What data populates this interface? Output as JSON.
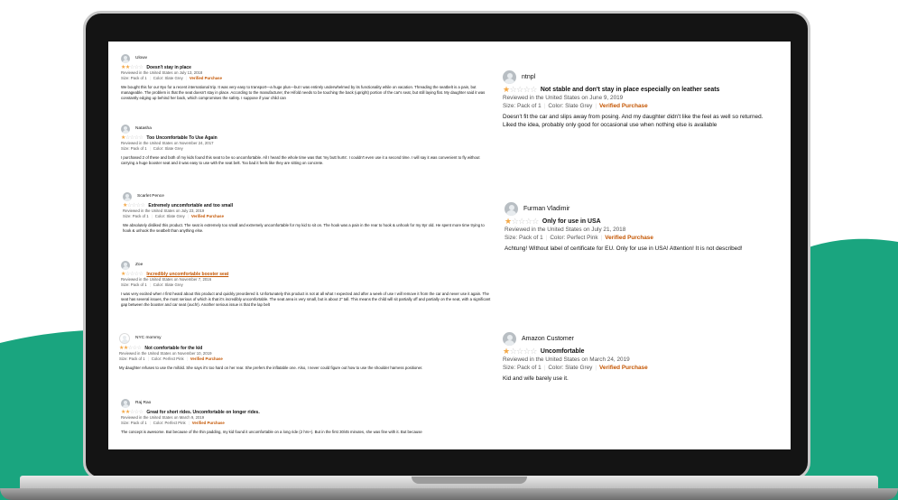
{
  "colors": {
    "green": "#1aa57f",
    "star": "#f3a847",
    "verified": "#c45500"
  },
  "reviews_left": [
    {
      "user": "Ulowv",
      "stars": 2,
      "title": "Doesn't stay in place",
      "date": "Reviewed in the United States on July 13, 2018",
      "size": "Size: Pack of 1",
      "color": "Color: Slate Grey",
      "verified": "Verified Purchase",
      "body": "We bought this for our 8yo for a recent international trip. It was very easy to transport—a huge plus—but I was entirely underwhelmed by its functionality while on vacation. Threading the seatbelt is a pain, but manageable. The problem is that the seat doesn't stay in place. According to the manufacturer, the Hifold needs to be touching the back (upright) portion of the car's seat, but still laying flat. My daughter said it was constantly edging up behind her back, which compromises the safety. I suppose if your child can"
    },
    {
      "user": "Natasha",
      "stars": 1,
      "title": "Too Uncomfortable To Use Again",
      "date": "Reviewed in the United States on November 24, 2017",
      "size": "Size: Pack of 1",
      "color": "Color: Slate Grey",
      "verified": "",
      "body": "I purchased 2 of these and both of my kids found this seat to be so uncomfortable. All I heard the whole time was that 'my butt hurts'. I couldn't even use it a second time. I will say it was convenient to fly without carrying a huge booster seat and it was easy to use with the seat belt. Too bad it feels like they are sitting on concrete."
    },
    {
      "user": "Scarlet Pence",
      "stars": 1,
      "title": "Extremely uncomfortable and too small",
      "date": "Reviewed in the United States on July 23, 2019",
      "size": "Size: Pack of 1",
      "color": "Color: Slate Grey",
      "verified": "Verified Purchase",
      "body": "We absolutely disliked this product. The seat is extremely too small and extremely uncomfortable for my kid to sit on. The hook was a pain in the rear to hook & unhook for my 8yr old. He spent more time trying to hook & unhook the seatbelt than anything else."
    },
    {
      "user": "Zoe",
      "stars": 1,
      "title": "Incredibly uncomfortable booster seat",
      "date": "Reviewed in the United States on November 7, 2016",
      "size": "Size: Pack of 1",
      "color": "Color: Slate Grey",
      "verified": "",
      "body": "I was very excited when I first heard about this product and quickly preordered it. Unfortunately this product is not at all what I expected and after a week of use I will remove it from the car and never use it again. The seat has several issues, the most serious of which is that it's incredibly uncomfortable. The seat area is very small, but is about 2\" tall. This means the child will sit partially off and partially on the seat, with a significant gap between the booster and car seat (ouch!). Another serious issue is that the lap belt"
    },
    {
      "user": "NYC mommy",
      "stars": 2,
      "title": "Not comfortable for the kid",
      "date": "Reviewed in the United States on November 10, 2019",
      "size": "Size: Pack of 1",
      "color": "Color: Perfect Pink",
      "verified": "Verified Purchase",
      "body": "My daughter refuses to use the mifold. She says it's too hard on her rear. She prefers the inflatable one. Also, I never could figure out how to use the shoulder harness positioner."
    },
    {
      "user": "Raj Rao",
      "stars": 2,
      "title": "Great for short rides. Uncomfortable on longer rides.",
      "date": "Reviewed in the United States on March 9, 2019",
      "size": "Size: Pack of 1",
      "color": "Color: Perfect Pink",
      "verified": "Verified Purchase",
      "body": "The concept is awesome. But because of the thin padding, my kid found it uncomfortable on a long ride (2 hrs+). But in the first 30/45 minutes, she was fine with it. But because"
    }
  ],
  "reviews_right": [
    {
      "user": "ntnpl",
      "stars": 1,
      "title": "Not stable and don't stay in place especially on leather seats",
      "date": "Reviewed in the United States on June 9, 2019",
      "size": "Size: Pack of 1",
      "color": "Color: Slate Grey",
      "verified": "Verified Purchase",
      "body": "Doesn't fit the car and slips away from posing. And my daughter didn't like the feel as well so returned. Liked the idea, probably only good for occasional use when nothing else is available"
    },
    {
      "user": "Furman Vladimir",
      "stars": 1,
      "title": "Only for use in USA",
      "date": "Reviewed in the United States on July 21, 2018",
      "size": "Size: Pack of 1",
      "color": "Color: Perfect Pink",
      "verified": "Verified Purchase",
      "body": "Achtung! Without label of certificate for EU. Only for use in USA! Attention! It is not described!"
    },
    {
      "user": "Amazon Customer",
      "stars": 1,
      "title": "Uncomfortable",
      "date": "Reviewed in the United States on March 24, 2019",
      "size": "Size: Pack of 1",
      "color": "Color: Slate Grey",
      "verified": "Verified Purchase",
      "body": "Kid and wife barely use it."
    }
  ]
}
